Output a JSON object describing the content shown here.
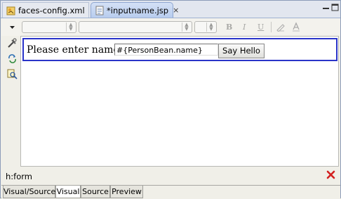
{
  "tabs": [
    {
      "label": "faces-config.xml",
      "active": false
    },
    {
      "label": "*inputname.jsp",
      "active": true,
      "close": "×"
    }
  ],
  "toolbar": {
    "bold": "B",
    "italic": "I",
    "underline": "U",
    "font_family": "",
    "font_size": "",
    "style": ""
  },
  "form": {
    "prompt": "Please enter name:",
    "input_value": "#{PersonBean.name}",
    "button_label": "Say Hello"
  },
  "status": {
    "tag": "h:form"
  },
  "bottom_tabs": [
    "Visual/Source",
    "Visual",
    "Source",
    "Preview"
  ],
  "active_bottom_tab": "Visual",
  "colors": {
    "form_border": "#2a34c9",
    "tab_active": "#b8cdee",
    "close_red": "#d32020"
  },
  "icons": {
    "faces_config": "faces-config-file-icon",
    "jsp": "jsp-file-icon",
    "minimize": "minimize-icon",
    "maximize": "maximize-icon",
    "palette_menu": "chevron-down-icon",
    "tools": "tools-icon",
    "refresh": "refresh-icon",
    "search": "search-icon",
    "remove": "red-x-icon"
  }
}
